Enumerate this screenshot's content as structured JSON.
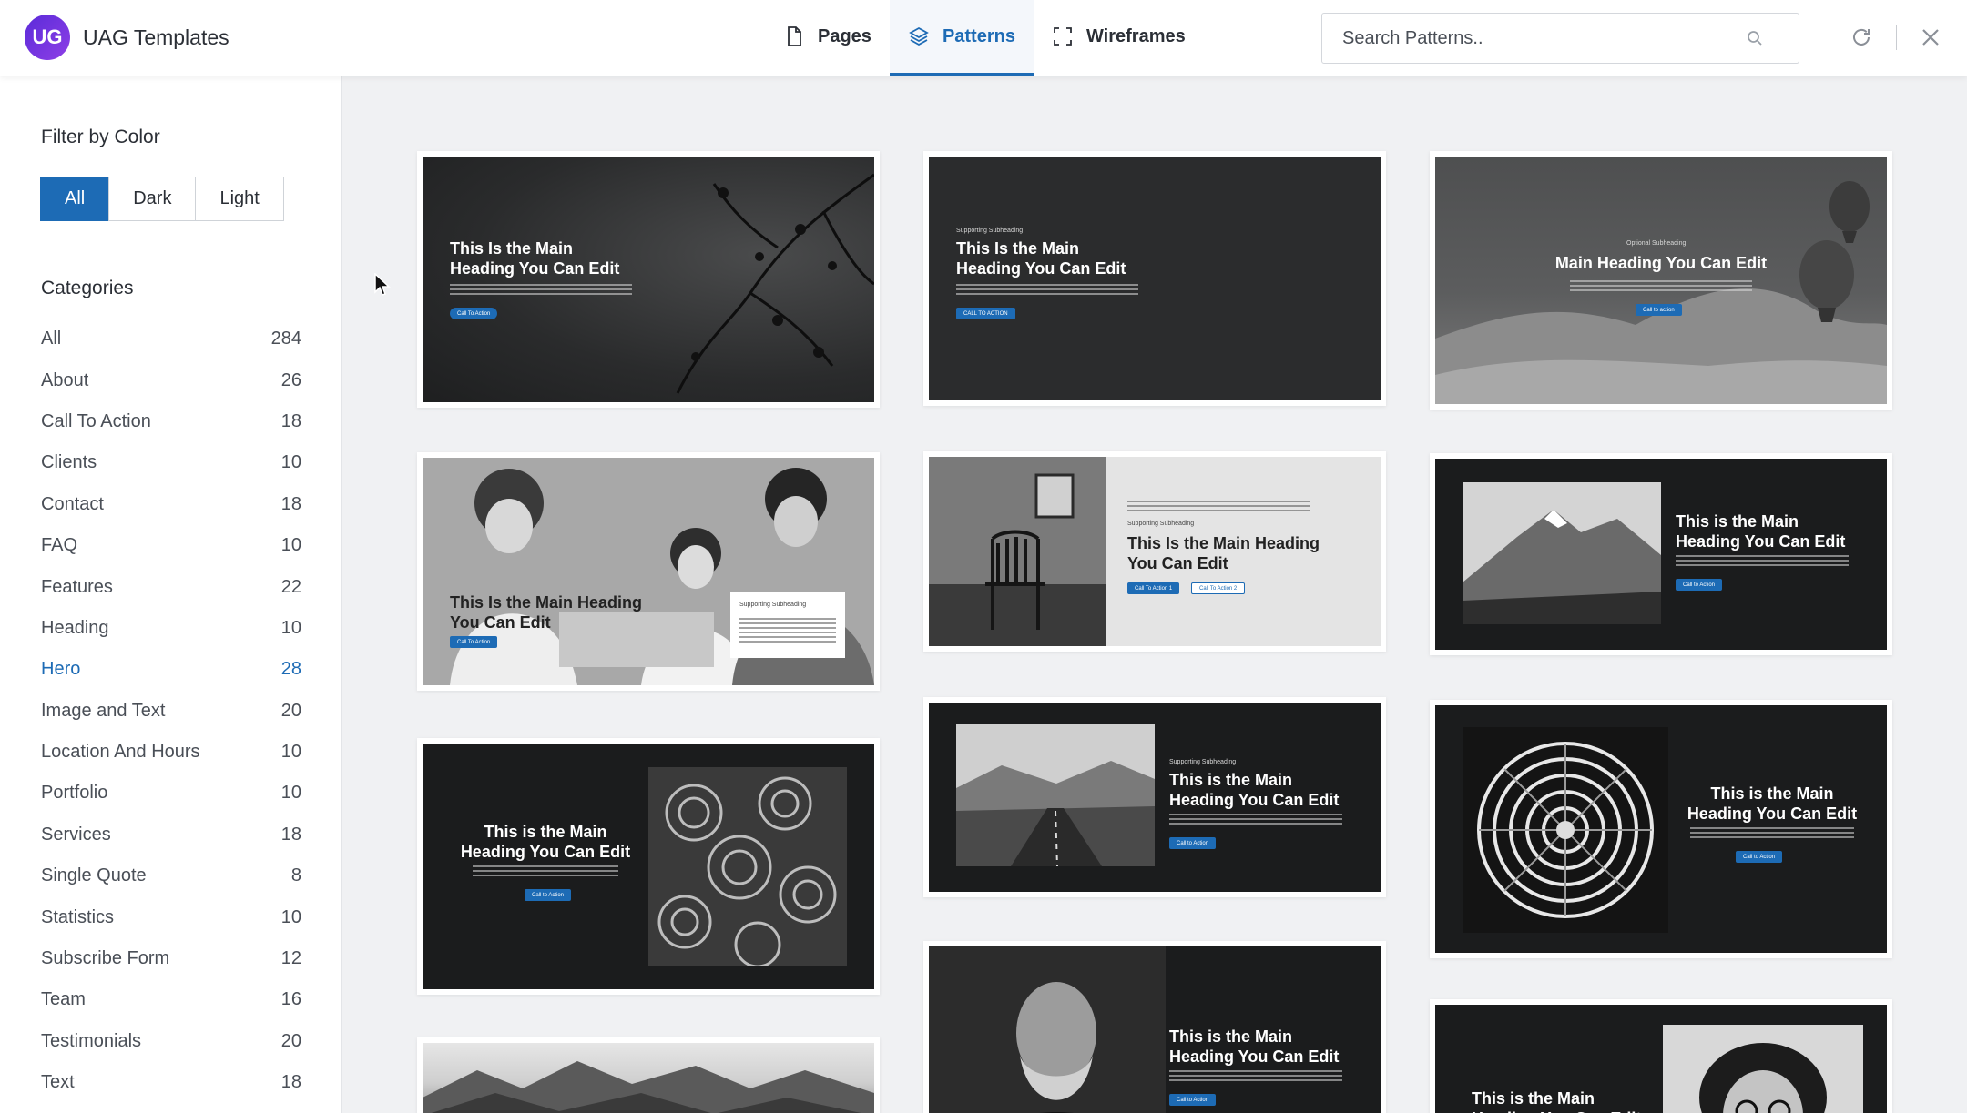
{
  "header": {
    "logo_text": "UG",
    "app_title": "UAG Templates",
    "tabs": [
      {
        "label": "Pages",
        "icon": "page-icon"
      },
      {
        "label": "Patterns",
        "icon": "layers-icon",
        "active": true
      },
      {
        "label": "Wireframes",
        "icon": "frame-icon"
      }
    ],
    "search_placeholder": "Search Patterns..",
    "accent_color": "#1d6bb5"
  },
  "sidebar": {
    "filter_title": "Filter by Color",
    "filters": [
      "All",
      "Dark",
      "Light"
    ],
    "active_filter": "All",
    "categories_title": "Categories",
    "categories": [
      {
        "name": "All",
        "count": "284"
      },
      {
        "name": "About",
        "count": "26"
      },
      {
        "name": "Call To Action",
        "count": "18"
      },
      {
        "name": "Clients",
        "count": "10"
      },
      {
        "name": "Contact",
        "count": "18"
      },
      {
        "name": "FAQ",
        "count": "10"
      },
      {
        "name": "Features",
        "count": "22"
      },
      {
        "name": "Heading",
        "count": "10"
      },
      {
        "name": "Hero",
        "count": "28"
      },
      {
        "name": "Image and Text",
        "count": "20"
      },
      {
        "name": "Location And Hours",
        "count": "10"
      },
      {
        "name": "Portfolio",
        "count": "10"
      },
      {
        "name": "Services",
        "count": "18"
      },
      {
        "name": "Single Quote",
        "count": "8"
      },
      {
        "name": "Statistics",
        "count": "10"
      },
      {
        "name": "Subscribe Form",
        "count": "12"
      },
      {
        "name": "Team",
        "count": "16"
      },
      {
        "name": "Testimonials",
        "count": "20"
      },
      {
        "name": "Text",
        "count": "18"
      }
    ],
    "active_category": "Hero"
  },
  "patterns": {
    "p1": {
      "heading": "This Is the Main Heading You Can Edit",
      "cta": "Call To Action"
    },
    "p2": {
      "sub": "Supporting Subheading",
      "heading": "This Is the Main Heading You Can Edit",
      "cta": "CALL TO ACTION"
    },
    "p3": {
      "sub": "Optional Subheading",
      "heading": "Main Heading You Can Edit",
      "cta": "Call to action"
    },
    "p4": {
      "heading": "This Is the Main Heading You Can Edit",
      "cta": "Call To Action",
      "sub": "Supporting Subheading"
    },
    "p5": {
      "sub": "Supporting Subheading",
      "heading": "This Is the Main Heading You Can Edit",
      "cta1": "Call To Action 1",
      "cta2": "Call To Action 2"
    },
    "p6": {
      "heading": "This is the Main Heading You Can Edit",
      "cta": "Call to Action"
    },
    "p7": {
      "heading": "This is the Main Heading You Can Edit",
      "cta": "Call to Action"
    },
    "p8": {
      "sub": "Supporting Subheading",
      "heading": "This is the Main Heading You Can Edit",
      "cta": "Call to Action"
    },
    "p9": {
      "heading": "This is the Main Heading You Can Edit",
      "cta": "Call to Action"
    },
    "p10": {
      "heading": "This is the Main Heading You Can Edit",
      "cta": "Call to Action"
    },
    "p11": {
      "heading": "This is the Main Heading You Can Edit"
    }
  }
}
